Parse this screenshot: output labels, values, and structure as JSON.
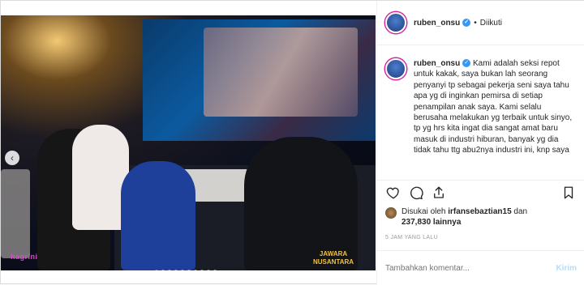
{
  "post": {
    "username": "ruben_onsu",
    "follow_status": "Diikuti",
    "separator": "•",
    "caption_user": "ruben_onsu",
    "caption_text": "Kami adalah seksi repot untuk kakak, saya bukan lah seorang penyanyi tp sebagai pekerja seni saya tahu apa yg di inginkan pemirsa di setiap penampilan anak saya. Kami selalu berusaha melakukan yg terbaik untuk sinyo, tp yg hrs kita ingat dia sangat amat baru masuk di industri hiburan, banyak yg dia tidak tahu ttg abu2nya industri ini, knp saya",
    "liked_by_prefix": "Disukai oleh",
    "liked_by_user": "irfansebaztian15",
    "liked_by_and": "dan",
    "likes_count": "237,830 lainnya",
    "timestamp": "5 JAM YANG LALU",
    "comment_placeholder": "Tambahkan komentar...",
    "post_button": "Kirim"
  },
  "photo": {
    "logo_left": "hagrini",
    "logo_right_line1": "JAWARA",
    "logo_right_line2": "NUSANTARA",
    "carousel_count": 10,
    "carousel_active": 0
  },
  "icons": {
    "like": "heart-icon",
    "comment": "comment-icon",
    "share": "share-icon",
    "save": "bookmark-icon",
    "prev": "chevron-left-icon",
    "verified": "verified-badge-icon"
  },
  "colors": {
    "accent": "#3897f0",
    "post_button": "#b2dffc"
  }
}
